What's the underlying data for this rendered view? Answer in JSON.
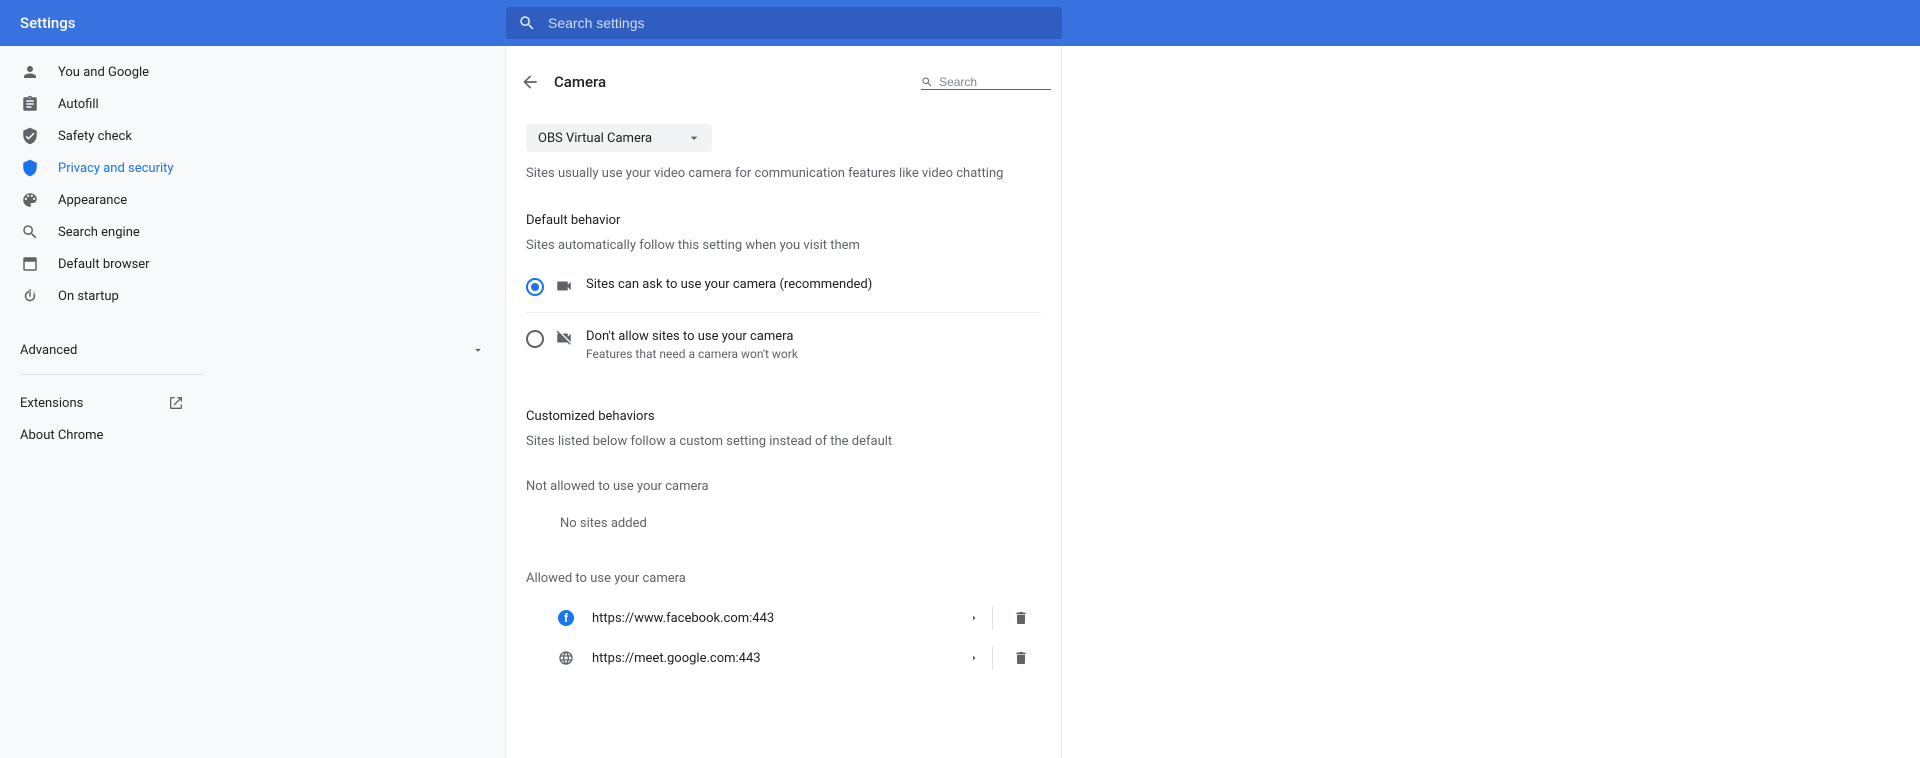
{
  "header": {
    "title": "Settings",
    "search_placeholder": "Search settings"
  },
  "sidebar": {
    "items": [
      {
        "label": "You and Google"
      },
      {
        "label": "Autofill"
      },
      {
        "label": "Safety check"
      },
      {
        "label": "Privacy and security"
      },
      {
        "label": "Appearance"
      },
      {
        "label": "Search engine"
      },
      {
        "label": "Default browser"
      },
      {
        "label": "On startup"
      }
    ],
    "advanced_label": "Advanced",
    "extensions_label": "Extensions",
    "about_label": "About Chrome"
  },
  "main": {
    "title": "Camera",
    "search_placeholder": "Search",
    "camera_select": "OBS Virtual Camera",
    "intro_text": "Sites usually use your video camera for communication features like video chatting",
    "default_behavior_heading": "Default behavior",
    "default_behavior_sub": "Sites automatically follow this setting when you visit them",
    "radio": [
      {
        "label": "Sites can ask to use your camera (recommended)"
      },
      {
        "label": "Don't allow sites to use your camera",
        "sub": "Features that need a camera won't work"
      }
    ],
    "custom_heading": "Customized behaviors",
    "custom_sub": "Sites listed below follow a custom setting instead of the default",
    "not_allowed_heading": "Not allowed to use your camera",
    "no_sites": "No sites added",
    "allowed_heading": "Allowed to use your camera",
    "allowed_sites": [
      {
        "url": "https://www.facebook.com:443",
        "icon": "facebook"
      },
      {
        "url": "https://meet.google.com:443",
        "icon": "globe"
      }
    ]
  }
}
